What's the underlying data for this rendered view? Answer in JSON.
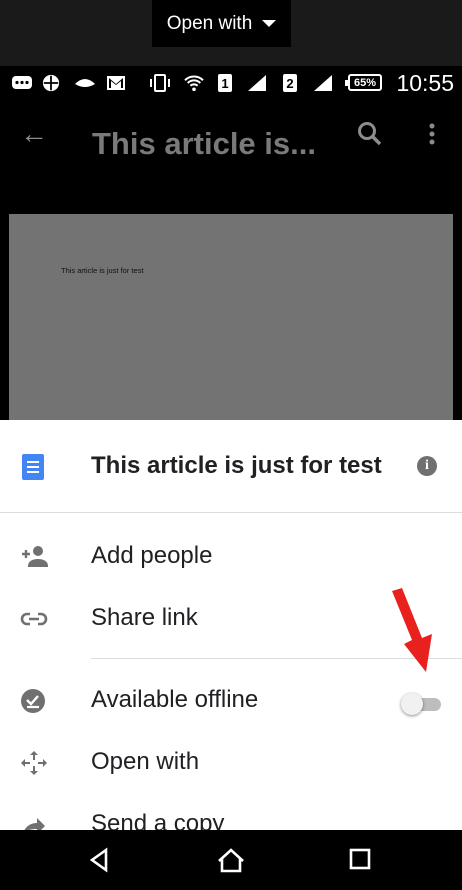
{
  "top_chip": {
    "label": "Open with"
  },
  "status_bar": {
    "time": "10:55",
    "battery": "65%",
    "sim1": "1",
    "sim2": "2",
    "icons": [
      "message-icon",
      "app-icon",
      "news-icon",
      "gmail-icon",
      "vibrate-icon",
      "wifi-icon",
      "signal-icon",
      "signal-icon"
    ]
  },
  "doc_header": {
    "title": "This article is...",
    "icons": [
      "back-arrow-icon",
      "search-icon",
      "more-vert-icon"
    ]
  },
  "preview": {
    "text": "This article is just for test"
  },
  "sheet": {
    "title": "This article is just for test",
    "items": [
      {
        "label": "Add people",
        "icon": "add-person-icon"
      },
      {
        "label": "Share link",
        "icon": "link-icon"
      },
      {
        "label": "Available offline",
        "icon": "offline-check-icon",
        "toggle_on": false
      },
      {
        "label": "Open with",
        "icon": "open-with-icon"
      },
      {
        "label": "Send a copy",
        "icon": "send-copy-icon"
      }
    ]
  },
  "navbar": {
    "icons": [
      "back-icon",
      "home-icon",
      "recents-icon"
    ]
  },
  "colors": {
    "accent_blue": "#4285f4",
    "annotation_red": "#e8201e",
    "scrim": "#737373"
  }
}
